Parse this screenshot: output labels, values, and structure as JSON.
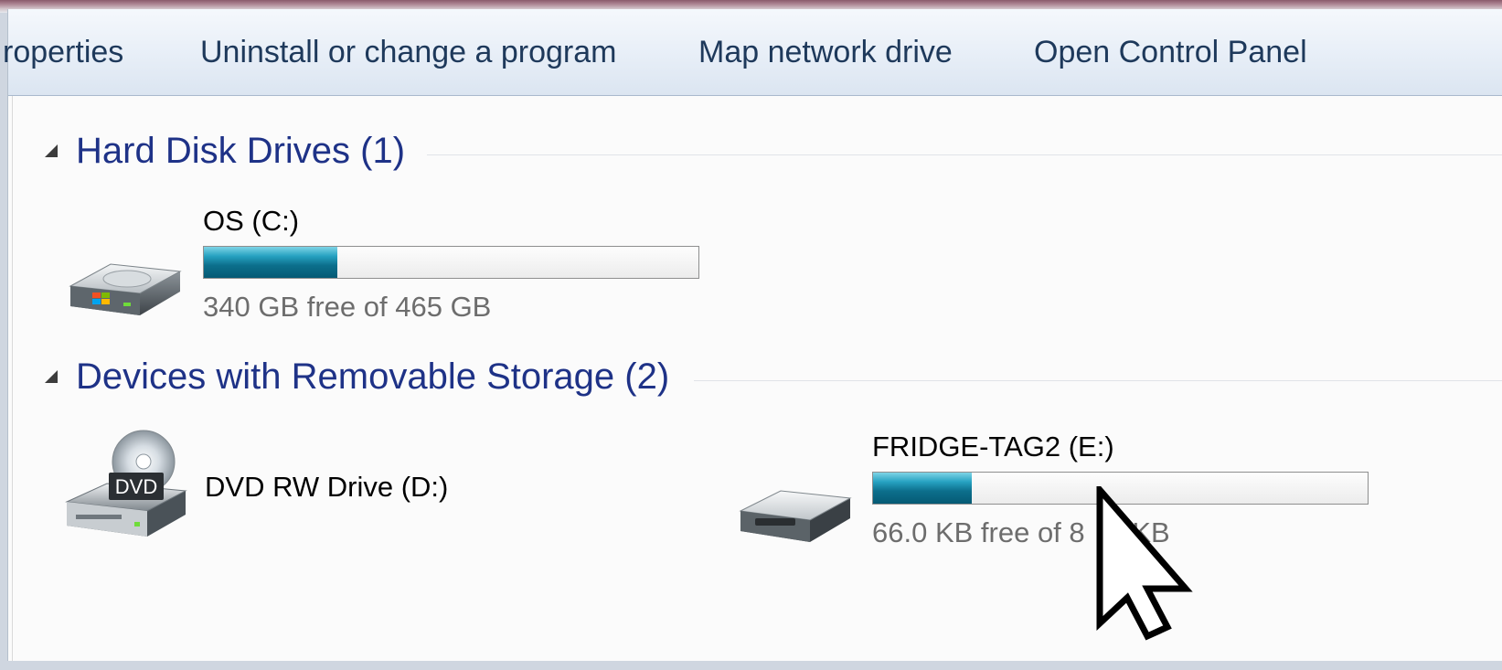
{
  "toolbar": {
    "items": [
      {
        "label": "roperties"
      },
      {
        "label": "Uninstall or change a program"
      },
      {
        "label": "Map network drive"
      },
      {
        "label": "Open Control Panel"
      }
    ]
  },
  "groups": [
    {
      "title": "Hard Disk Drives (1)",
      "drives": [
        {
          "name": "OS (C:)",
          "space_text": "340 GB free of 465 GB",
          "used_fraction": 0.27,
          "icon": "windows-hard-drive-icon"
        }
      ]
    },
    {
      "title": "Devices with Removable Storage (2)",
      "drives": [
        {
          "name": "DVD RW Drive (D:)",
          "icon": "dvd-drive-icon",
          "icon_badge": "DVD"
        },
        {
          "name": "FRIDGE-TAG2 (E:)",
          "space_text": "66.0 KB free of 8   5 KB",
          "used_fraction": 0.2,
          "icon": "removable-drive-icon"
        }
      ]
    }
  ],
  "colors": {
    "group_header": "#1e3287",
    "toolbar_text": "#1e395b",
    "bar_fill": "#0c6f8c",
    "space_text": "#6d6d6d"
  },
  "cursor": {
    "icon": "mouse-pointer-icon"
  }
}
